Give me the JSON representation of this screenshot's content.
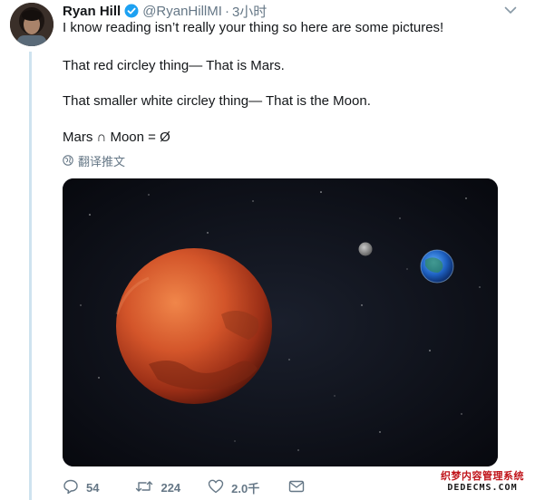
{
  "tweet": {
    "author_name": "Ryan Hill",
    "handle": "@RyanHillMI",
    "separator": "·",
    "time": "3小时",
    "lines": [
      "I know reading isn’t really your thing so here are some pictures!",
      "That red circley thing— That is Mars.",
      "That smaller white circley thing— That is the Moon.",
      "Mars ∩ Moon = Ø"
    ],
    "translate_label": "翻译推文"
  },
  "actions": {
    "replies": "54",
    "retweets": "224",
    "likes": "2.0千"
  },
  "colors": {
    "verified": "#1da1f2",
    "muted": "#657786",
    "thread_line": "#cfe3ef"
  },
  "icons": [
    "verified-badge-icon",
    "chevron-down-icon",
    "globe-icon",
    "reply-icon",
    "retweet-icon",
    "like-icon",
    "message-icon"
  ],
  "watermark": {
    "line1": "织梦内容管理系统",
    "line2": "DEDECMS.COM"
  }
}
